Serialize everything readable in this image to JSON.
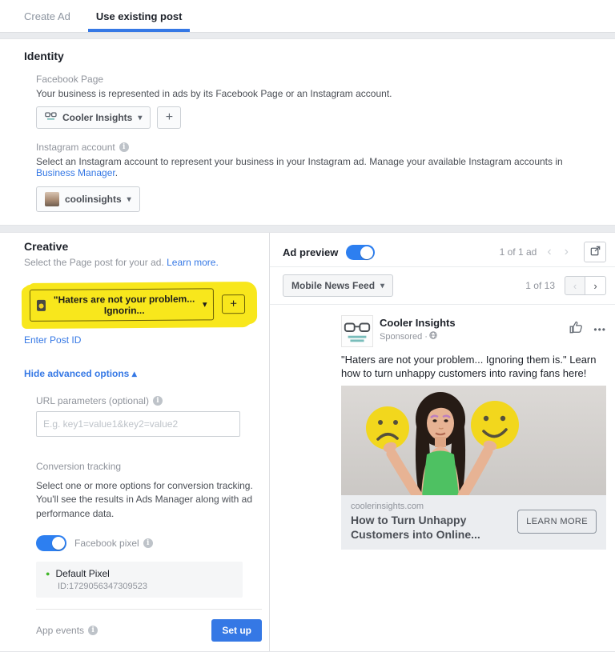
{
  "colors": {
    "accent": "#3578e5",
    "toggle": "#2d7ff0",
    "highlight": "#f8e71c",
    "success": "#42b72a",
    "smiley": "#f2d71d",
    "shirt": "#4ec162",
    "skin": "#e7b394",
    "hair": "#261b15"
  },
  "icons": {
    "caret_down": "▾",
    "caret_up": "▴",
    "plus": "+",
    "chevron_left": "‹",
    "chevron_right": "›",
    "more": "•••",
    "info": "i",
    "dot": "●"
  },
  "tabs": {
    "create_ad": "Create Ad",
    "use_existing_post": "Use existing post"
  },
  "identity": {
    "title": "Identity",
    "facebook_page": {
      "label": "Facebook Page",
      "description": "Your business is represented in ads by its Facebook Page or an Instagram account.",
      "selected": "Cooler Insights"
    },
    "instagram": {
      "label": "Instagram account",
      "description": "Select an Instagram account to represent your business in your Instagram ad. Manage your available Instagram accounts in ",
      "link": "Business Manager",
      "suffix": ".",
      "selected": "coolinsights"
    }
  },
  "creative": {
    "title": "Creative",
    "subtitle": "Select the Page post for your ad. ",
    "learn_more": "Learn more.",
    "post_select": "\"Haters are not your problem... Ignorin...",
    "enter_post_id": "Enter Post ID",
    "hide_advanced": "Hide advanced options ",
    "url_parameters": {
      "label": "URL parameters (optional)",
      "placeholder": "E.g. key1=value1&key2=value2"
    },
    "conversion": {
      "label": "Conversion tracking",
      "description": "Select one or more options for conversion tracking. You'll see the results in Ads Manager along with ad performance data.",
      "pixel_label": "Facebook pixel",
      "pixel_name": "Default Pixel",
      "pixel_id": "ID:1729056347309523",
      "app_events": "App events",
      "set_up": "Set up"
    }
  },
  "preview": {
    "title": "Ad preview",
    "ad_pager": "1 of 1 ad",
    "placement": "Mobile News Feed ",
    "frame_pager": "1 of 13",
    "post": {
      "page_name": "Cooler Insights",
      "sponsored": "Sponsored · ",
      "body": "\"Haters are not your problem... Ignoring them is.\" Learn how to turn unhappy customers into raving fans here!",
      "domain": "coolerinsights.com",
      "headline": "How to Turn Unhappy Customers into Online...",
      "cta": "LEARN MORE"
    }
  }
}
